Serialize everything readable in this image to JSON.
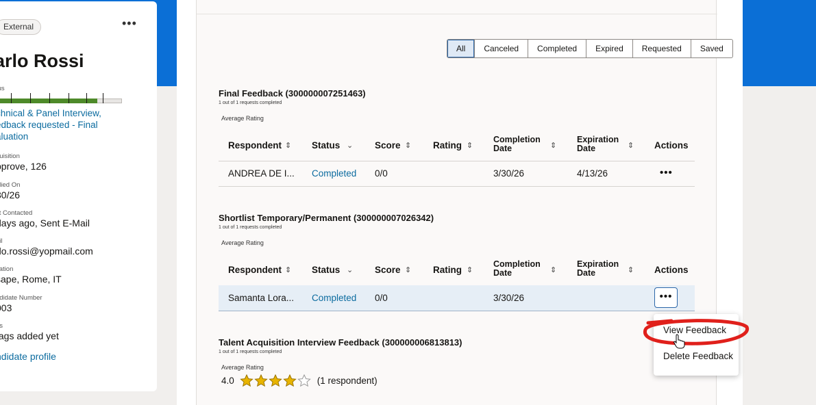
{
  "candidate": {
    "tag": "External",
    "name": "arlo Rossi",
    "status_label": "tus",
    "status_progress_fraction": 0.8,
    "stage_lines": [
      "chnical & Panel Interview,",
      "edback requested - Final",
      "aluation"
    ],
    "fields": [
      {
        "label": "quisition",
        "value": "pprove, 126"
      },
      {
        "label": "plied On",
        "value": "30/26"
      },
      {
        "label": "st Contacted",
        "value": "days ago, Sent E-Mail"
      },
      {
        "label": "ail",
        "value": "rlo.rossi@yopmail.com"
      },
      {
        "label": "cation",
        "value": "sape, Rome, IT"
      },
      {
        "label": "ndidate Number",
        "value": "003"
      },
      {
        "label": "gs",
        "value": "tags added yet"
      }
    ],
    "profile_link": "ndidate profile"
  },
  "filters": [
    "All",
    "Canceled",
    "Completed",
    "Expired",
    "Requested",
    "Saved"
  ],
  "active_filter": "All",
  "columns": {
    "respondent": "Respondent",
    "status": "Status",
    "score": "Score",
    "rating": "Rating",
    "completion_1": "Completion",
    "completion_2": "Date",
    "expiration_1": "Expiration",
    "expiration_2": "Date",
    "actions": "Actions"
  },
  "sections": [
    {
      "title": "Final Feedback (300000007251463)",
      "subtitle": "1 out of 1 requests completed",
      "avg_label": "Average Rating",
      "row": {
        "respondent": "ANDREA DE I...",
        "status": "Completed",
        "score": "0/0",
        "rating": "",
        "completion": "3/30/26",
        "expiration": "4/13/26"
      }
    },
    {
      "title": "Shortlist Temporary/Permanent (300000007026342)",
      "subtitle": "1 out of 1 requests completed",
      "avg_label": "Average Rating",
      "row": {
        "respondent": "Samanta Lora...",
        "status": "Completed",
        "score": "0/0",
        "rating": "",
        "completion": "3/30/26",
        "expiration": ""
      }
    },
    {
      "title": "Talent Acquisition Interview Feedback (300000006813813)",
      "subtitle": "1 out of 1 requests completed",
      "avg_label": "Average Rating",
      "rating_value": "4.0",
      "stars_filled": 4,
      "stars_total": 5,
      "respondents": "(1 respondent)"
    }
  ],
  "menu": {
    "view": "View Feedback",
    "delete": "Delete Feedback"
  },
  "icons": {
    "more": "more-horizontal-icon",
    "sort": "sort-updown-icon",
    "sort_desc": "chevron-down-icon",
    "star": "star-icon",
    "cursor": "hand-cursor-icon"
  },
  "colors": {
    "brand_blue": "#0b6fd6",
    "link": "#0b6b9f",
    "progress_green": "#4e8a2a",
    "annotation_red": "#e0201b",
    "star_gold": "#e8b400"
  }
}
